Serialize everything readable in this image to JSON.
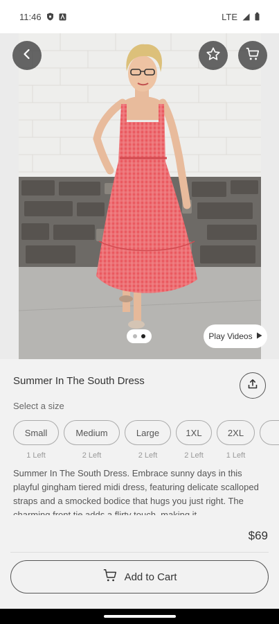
{
  "status_bar": {
    "time": "11:46",
    "network": "LTE"
  },
  "product": {
    "title": "Summer In The South Dress",
    "size_prompt": "Select a size",
    "sizes": [
      {
        "label": "Small",
        "stock": "1 Left"
      },
      {
        "label": "Medium",
        "stock": "2 Left"
      },
      {
        "label": "Large",
        "stock": "2 Left"
      },
      {
        "label": "1XL",
        "stock": "2 Left"
      },
      {
        "label": "2XL",
        "stock": "1 Left"
      }
    ],
    "description": "Summer In The South Dress. Embrace sunny days in this playful gingham tiered midi dress, featuring delicate scalloped straps and a smocked bodice that hugs you just right. The charming front tie adds a flirty touch, making it",
    "price": "$69"
  },
  "gallery": {
    "play_videos_label": "Play Videos",
    "image_count": 2,
    "active_index": 2
  },
  "actions": {
    "add_to_cart_label": "Add to Cart"
  },
  "icons": [
    "shield-icon",
    "a-icon",
    "signal-icon",
    "battery-icon",
    "back-arrow-icon",
    "star-icon",
    "cart-icon",
    "play-icon",
    "share-icon",
    "cart-icon"
  ],
  "colors": {
    "dress": "#e8555b",
    "overlay_button": "#464646",
    "panel": "#f2f2f2"
  }
}
